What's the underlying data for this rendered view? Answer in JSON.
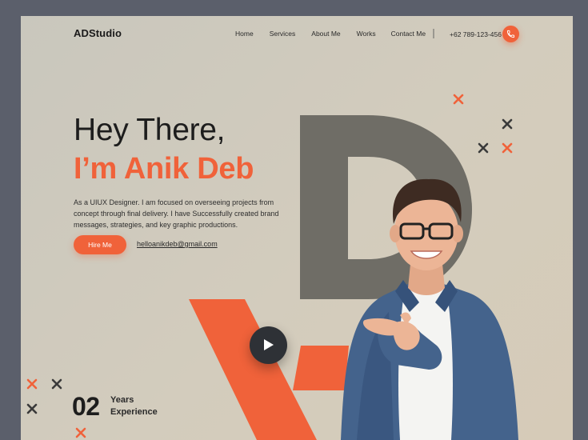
{
  "brand": {
    "logo": "ADStudio"
  },
  "nav": {
    "items": [
      "Home",
      "Services",
      "About Me",
      "Works",
      "Contact Me"
    ]
  },
  "contact": {
    "phone": "+62 789-123-456",
    "phone_icon": "phone-icon"
  },
  "hero": {
    "greeting": "Hey There,",
    "name_line": "I’m Anik Deb",
    "bio": "As a UIUX Designer. I am focused on overseeing projects from concept through final delivery. I have Successfully created brand messages, strategies, and key graphic productions.",
    "hire_label": "Hire Me",
    "email": "helloanikdeb@gmail.com",
    "play_icon": "play-icon"
  },
  "stats": {
    "number": "02",
    "label_line1": "Years",
    "label_line2": "Experience"
  },
  "colors": {
    "accent": "#f0623a",
    "dark": "#1d1d1d",
    "letter_d": "#6f6d66",
    "play_bg": "#2e3136"
  }
}
